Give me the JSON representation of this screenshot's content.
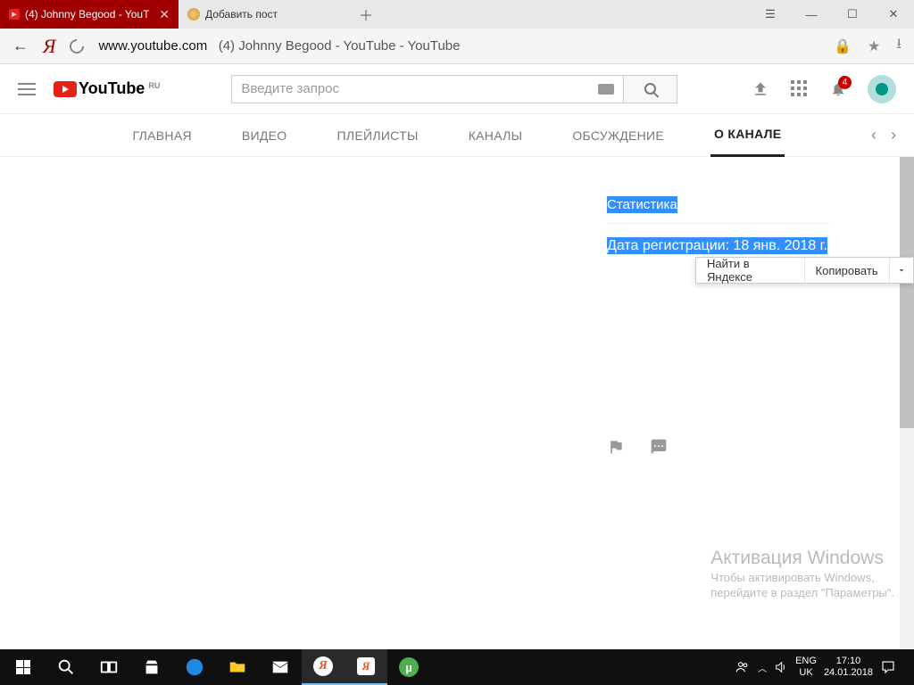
{
  "browser": {
    "tabs": [
      {
        "title": "(4) Johnny Begood - YouT"
      },
      {
        "title": "Добавить пост"
      }
    ],
    "url_domain": "www.youtube.com",
    "page_title": "(4) Johnny Begood - YouTube - YouTube"
  },
  "yt": {
    "brand": "YouTube",
    "region": "RU",
    "search_placeholder": "Введите запрос",
    "notif_count": "4",
    "tabs": {
      "home": "ГЛАВНАЯ",
      "videos": "ВИДЕО",
      "playlists": "ПЛЕЙЛИСТЫ",
      "channels": "КАНАЛЫ",
      "discussion": "ОБСУЖДЕНИЕ",
      "about": "О КАНАЛЕ"
    }
  },
  "about": {
    "stats_heading": "Статистика",
    "join_date": "Дата регистрации: 18 янв. 2018 г."
  },
  "context_menu": {
    "search": "Найти в Яндексе",
    "copy": "Копировать"
  },
  "watermark": {
    "title": "Активация Windows",
    "line1": "Чтобы активировать Windows,",
    "line2": "перейдите в раздел \"Параметры\"."
  },
  "taskbar": {
    "lang1": "ENG",
    "lang2": "UK",
    "time": "17:10",
    "date": "24.01.2018"
  }
}
